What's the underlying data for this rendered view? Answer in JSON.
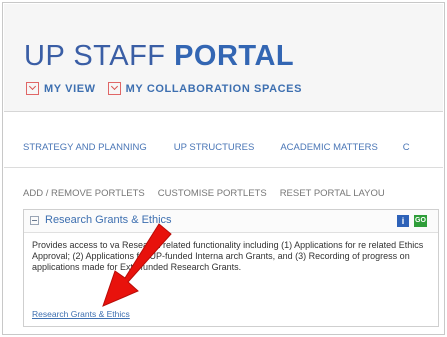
{
  "header": {
    "title_light": "UP STAFF ",
    "title_bold": "PORTAL",
    "nav": [
      {
        "label": "MY VIEW"
      },
      {
        "label": "MY COLLABORATION SPACES"
      }
    ]
  },
  "menu": {
    "items": [
      {
        "label": "STRATEGY AND PLANNING"
      },
      {
        "label": "UP STRUCTURES"
      },
      {
        "label": "ACADEMIC MATTERS"
      },
      {
        "label": "C"
      }
    ]
  },
  "tools": {
    "items": [
      {
        "label": "ADD / REMOVE PORTLETS"
      },
      {
        "label": "CUSTOMISE PORTLETS"
      },
      {
        "label": "RESET PORTAL LAYOU"
      }
    ]
  },
  "portlet": {
    "title": "Research Grants & Ethics",
    "info_label": "i",
    "go_label": "GO",
    "description": "Provides access to va      Research related functionality including (1) Applications for re        related Ethics Approval; (2) Applications for UP-funded Interna     arch Grants, and (3) Recording of progress on applications made for Exte      funded Research Grants.",
    "link": "Research Grants & Ethics"
  },
  "colors": {
    "accent_blue": "#3d6fb0",
    "annotation_arrow": "#e8120c"
  }
}
